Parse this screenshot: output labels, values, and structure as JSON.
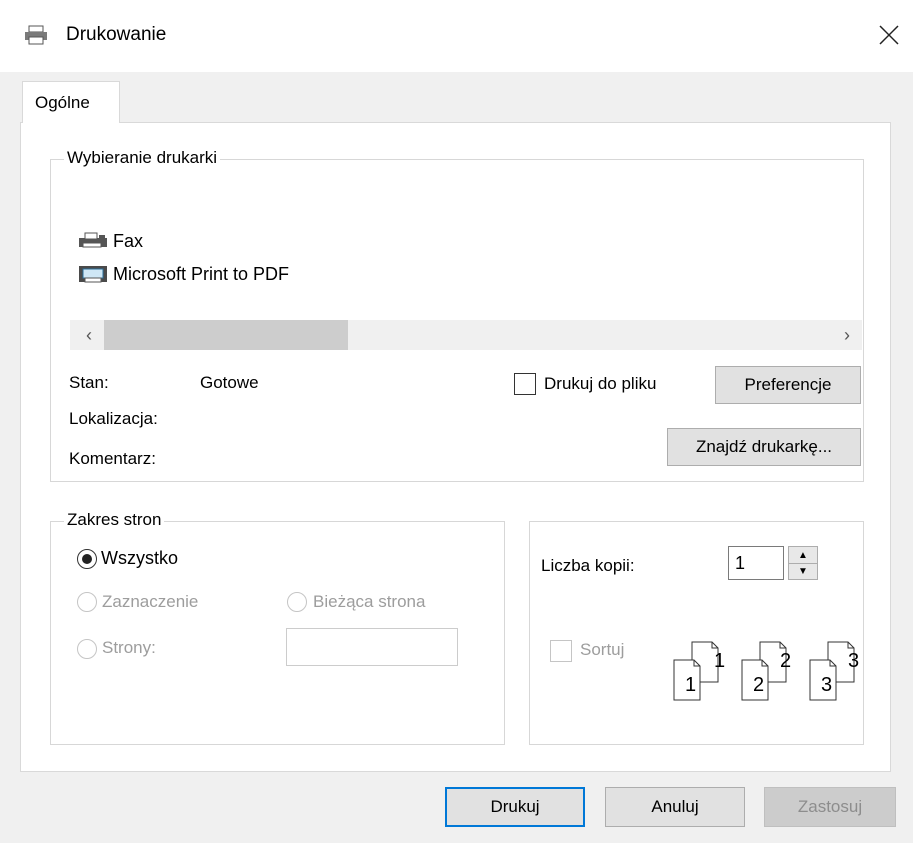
{
  "window": {
    "title": "Drukowanie"
  },
  "tabs": [
    {
      "label": "Ogólne",
      "active": true
    }
  ],
  "printer_group": {
    "legend": "Wybieranie drukarki",
    "printers": [
      {
        "name": "Fax",
        "icon": "fax-icon"
      },
      {
        "name": "Microsoft Print to PDF",
        "icon": "printer-icon"
      }
    ],
    "status_label": "Stan:",
    "status_value": "Gotowe",
    "location_label": "Lokalizacja:",
    "comment_label": "Komentarz:",
    "print_to_file_label": "Drukuj do pliku",
    "preferences_label": "Preferencje",
    "find_printer_label": "Znajdź drukarkę..."
  },
  "range_group": {
    "legend": "Zakres stron",
    "all_label": "Wszystko",
    "selection_label": "Zaznaczenie",
    "current_page_label": "Bieżąca strona",
    "pages_label": "Strony:"
  },
  "copies_group": {
    "copies_label": "Liczba kopii:",
    "copies_value": "1",
    "collate_label": "Sortuj",
    "collate_pages": [
      "1",
      "2",
      "3"
    ]
  },
  "footer": {
    "print_label": "Drukuj",
    "cancel_label": "Anuluj",
    "apply_label": "Zastosuj"
  },
  "colors": {
    "accent": "#0078d7",
    "disabled_text": "#9d9d9d"
  }
}
